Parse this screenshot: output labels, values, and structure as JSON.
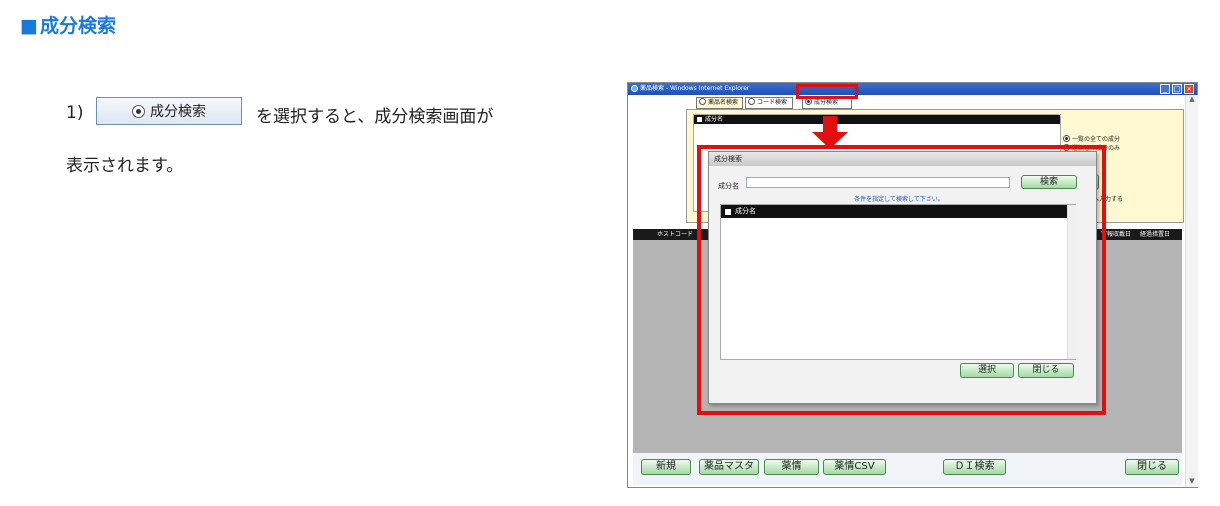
{
  "heading": {
    "square": "■",
    "text": "成分検索"
  },
  "step": {
    "number": "1)",
    "button_label": "成分検索",
    "text_after": "を選択すると、成分検索画面が",
    "text_line2": "表示されます。"
  },
  "window": {
    "title": "薬品検索 - Windows Internet Explorer",
    "controls": {
      "min": "_",
      "max": "□",
      "close": "×"
    },
    "tabs": [
      "薬品名検索",
      "コード検索",
      "成分検索"
    ],
    "panel_header": "成分名",
    "options": [
      "一覧の全ての成分",
      "選択した成分のみ"
    ],
    "side_text": "へ入力する",
    "small_btn": "",
    "table_headers": [
      "ホストコード",
      "",
      "",
      "",
      "",
      "",
      "",
      "",
      "",
      "",
      "",
      "",
      "",
      "",
      "",
      "",
      "",
      "",
      "",
      "",
      "",
      "",
      "官報収載日",
      "経過措置日"
    ],
    "bottom_buttons": [
      "新規",
      "薬品マスタ",
      "薬情",
      "薬情CSV",
      "ＤＩ検索",
      "閉じる"
    ],
    "scroll": {
      "up": "▲",
      "down": "▼"
    }
  },
  "dialog": {
    "title": "成分検索",
    "label": "成分名",
    "search_button": "検索",
    "hint": "条件を指定して検索して下さい。",
    "list_header": "成分名",
    "select_button": "選択",
    "close_button": "閉じる"
  },
  "colors": {
    "heading": "#1a7ad9",
    "highlight": "#e01010",
    "button_green": "#a3d9a3"
  }
}
